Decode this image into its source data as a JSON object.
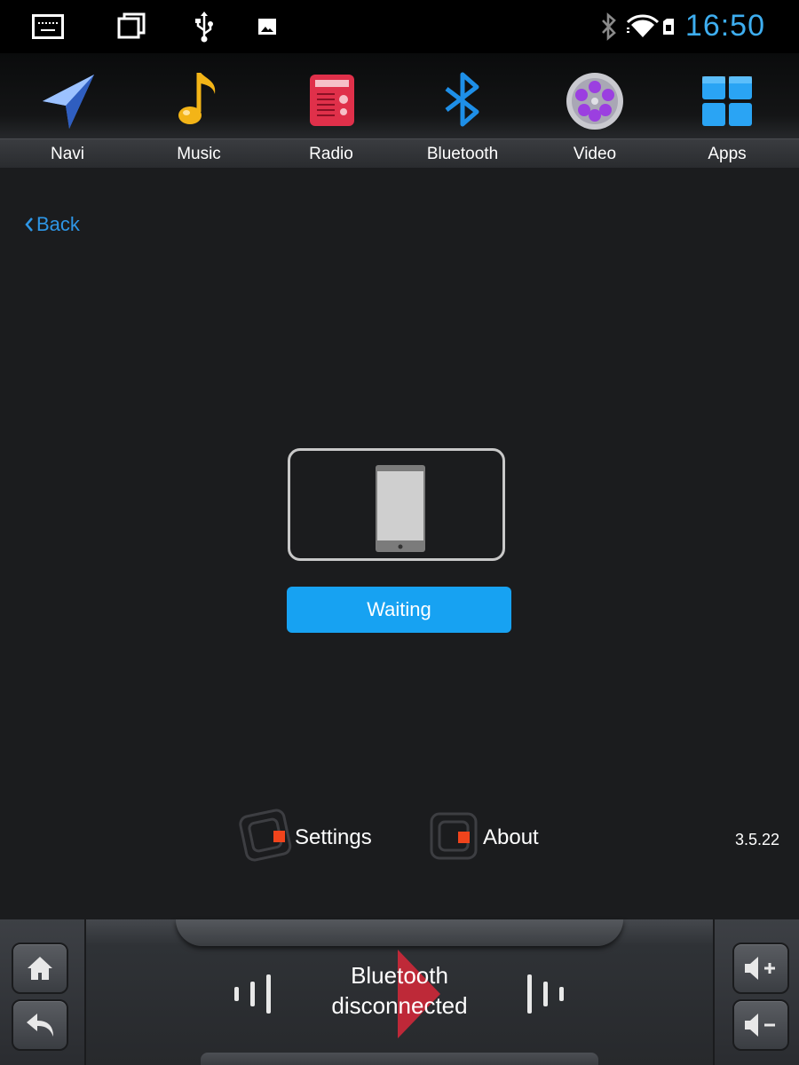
{
  "status_bar": {
    "time": "16:50",
    "icons": [
      "keyboard-icon",
      "recent-apps-icon",
      "usb-icon",
      "image-icon",
      "bluetooth-icon",
      "wifi-icon",
      "sim-icon"
    ],
    "accent_color": "#3eaef0"
  },
  "launcher": {
    "apps": [
      {
        "label": "Navi",
        "icon": "navigation-arrow-icon"
      },
      {
        "label": "Music",
        "icon": "music-note-icon"
      },
      {
        "label": "Radio",
        "icon": "radio-icon"
      },
      {
        "label": "Bluetooth",
        "icon": "bluetooth-icon"
      },
      {
        "label": "Video",
        "icon": "film-reel-icon"
      },
      {
        "label": "Apps",
        "icon": "app-grid-icon"
      }
    ]
  },
  "content": {
    "back_label": "Back",
    "device_icon": "phone-icon",
    "status_button_label": "Waiting",
    "settings_label": "Settings",
    "about_label": "About",
    "version": "3.5.22",
    "button_color": "#17a2f2",
    "link_color": "#2e96e6"
  },
  "dock": {
    "status_text_line1": "Bluetooth",
    "status_text_line2": "disconnected",
    "icons": [
      "home-icon",
      "return-icon",
      "volume-up-icon",
      "volume-down-icon"
    ]
  }
}
